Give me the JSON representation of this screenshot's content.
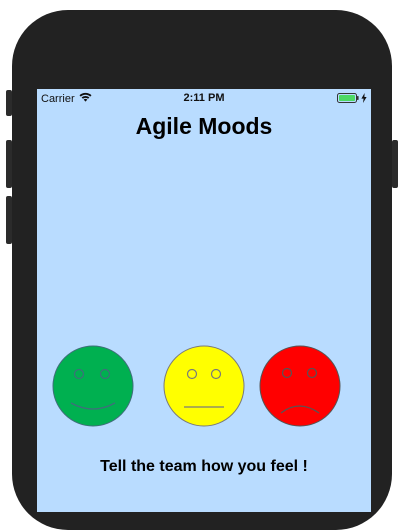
{
  "status_bar": {
    "carrier": "Carrier",
    "time": "2:11 PM",
    "wifi_icon": "wifi-icon",
    "battery_icon": "battery-charging-icon"
  },
  "app": {
    "title": "Agile Moods",
    "caption": "Tell the team how you feel !"
  },
  "moods": [
    {
      "icon": "happy-face-icon",
      "color": "#00b050",
      "expression": "happy"
    },
    {
      "icon": "neutral-face-icon",
      "color": "#ffff00",
      "expression": "neutral"
    },
    {
      "icon": "sad-face-icon",
      "color": "#ff0000",
      "expression": "sad"
    }
  ],
  "colors": {
    "background": "#b9dcff",
    "device_frame": "#222222",
    "battery": "#4cd964"
  }
}
